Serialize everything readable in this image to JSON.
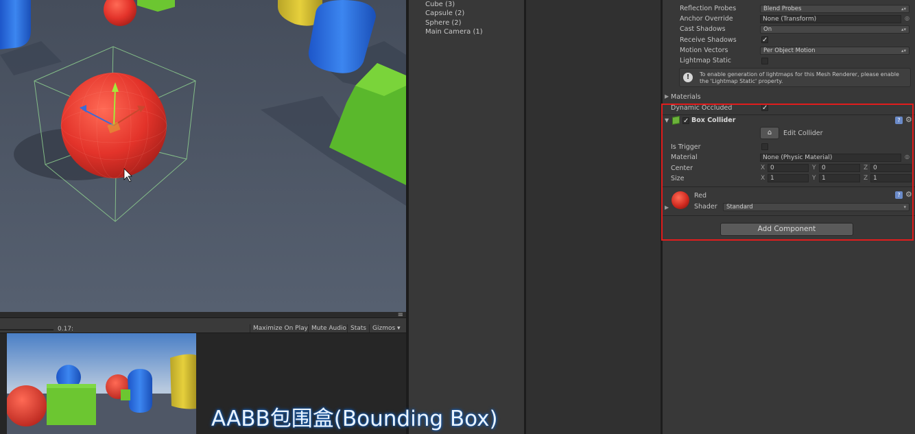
{
  "game_toolbar": {
    "scale_value": "0.17:",
    "buttons": [
      "Maximize On Play",
      "Mute Audio",
      "Stats",
      "Gizmos"
    ],
    "menu_glyph": "≡"
  },
  "hierarchy": {
    "items": [
      "Cube (3)",
      "Capsule (2)",
      "Sphere (2)",
      "Main Camera (1)"
    ]
  },
  "inspector": {
    "mesh_renderer": {
      "reflection_probes_label": "Reflection Probes",
      "reflection_probes_value": "Blend Probes",
      "anchor_override_label": "Anchor Override",
      "anchor_override_value": "None (Transform)",
      "cast_shadows_label": "Cast Shadows",
      "cast_shadows_value": "On",
      "receive_shadows_label": "Receive Shadows",
      "motion_vectors_label": "Motion Vectors",
      "motion_vectors_value": "Per Object Motion",
      "lightmap_static_label": "Lightmap Static",
      "info_line1": "To enable generation of lightmaps for this Mesh Renderer, please enable",
      "info_line2": "the 'Lightmap Static' property.",
      "materials_label": "Materials",
      "dynamic_occluded_label": "Dynamic Occluded"
    },
    "box_collider": {
      "title": "Box Collider",
      "edit_collider_label": "Edit Collider",
      "is_trigger_label": "Is Trigger",
      "material_label": "Material",
      "material_value": "None (Physic Material)",
      "center_label": "Center",
      "center": {
        "x": "0",
        "y": "0",
        "z": "0"
      },
      "size_label": "Size",
      "size": {
        "x": "1",
        "y": "1",
        "z": "1"
      },
      "axis_x": "X",
      "axis_y": "Y",
      "axis_z": "Z"
    },
    "material": {
      "name": "Red",
      "shader_label": "Shader",
      "shader_value": "Standard"
    },
    "add_component_label": "Add Component"
  },
  "caption": "AABB包围盒(Bounding Box)",
  "colors": {
    "highlight": "#e31c1c",
    "sphere_red": "#e8352b",
    "cube_green": "#6cc631",
    "capsule_blue": "#2a6ee0",
    "capsule_yellow": "#d8c233"
  }
}
